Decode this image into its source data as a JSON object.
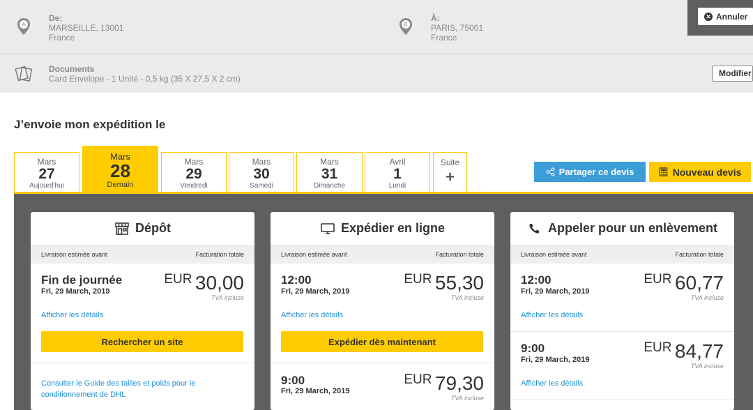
{
  "route": {
    "from": {
      "label": "De:",
      "city": "MARSEILLE, 13001",
      "country": "France",
      "marker": "A"
    },
    "to": {
      "label": "À:",
      "city": "PARIS, 75001",
      "country": "France",
      "marker": "B"
    },
    "cancel_label": "Annuler"
  },
  "package": {
    "type": "Documents",
    "description": "Card Envelope - 1 Unité - 0,5 kg (35 X 27,5 X 2 cm)",
    "modify_label": "Modifier"
  },
  "heading": "J’envoie mon expédition le",
  "tabs": [
    {
      "month": "Mars",
      "day": "27",
      "weekday": "Aujourd'hui"
    },
    {
      "month": "Mars",
      "day": "28",
      "weekday": "Demain"
    },
    {
      "month": "Mars",
      "day": "29",
      "weekday": "Vendredi"
    },
    {
      "month": "Mars",
      "day": "30",
      "weekday": "Samedi"
    },
    {
      "month": "Mars",
      "day": "31",
      "weekday": "Dimanche"
    },
    {
      "month": "Avril",
      "day": "1",
      "weekday": "Lundi"
    },
    {
      "month": "Suite",
      "day": "+",
      "weekday": ""
    }
  ],
  "actions": {
    "share_label": "Partager ce devis",
    "new_quote_label": "Nouveau devis"
  },
  "cards": [
    {
      "title": "Dépôt",
      "icon": "store-icon",
      "col_left": "Livraison estimée avant",
      "col_right": "Facturation totale",
      "options": [
        {
          "time": "Fin de journée",
          "date": "Fri, 29 March, 2019",
          "currency": "EUR",
          "amount": "30,00",
          "vat": "TVA incluse",
          "details": "Afficher les détails"
        }
      ],
      "button": "Rechercher un site",
      "guide": "Consulter le Guide des tailles et poids pour le conditionnement de DHL"
    },
    {
      "title": "Expédier en ligne",
      "icon": "monitor-icon",
      "col_left": "Livraison estimée avant",
      "col_right": "Facturation totale",
      "options": [
        {
          "time": "12:00",
          "date": "Fri, 29 March, 2019",
          "currency": "EUR",
          "amount": "55,30",
          "vat": "TVA incluse",
          "details": "Afficher les détails"
        },
        {
          "time": "9:00",
          "date": "Fri, 29 March, 2019",
          "currency": "EUR",
          "amount": "79,30",
          "vat": "TVA incluse"
        }
      ],
      "button": "Expédier dès maintenant"
    },
    {
      "title": "Appeler pour un enlèvement",
      "icon": "phone-icon",
      "col_left": "Livraison estimée avant",
      "col_right": "Facturation totale",
      "options": [
        {
          "time": "12:00",
          "date": "Fri, 29 March, 2019",
          "currency": "EUR",
          "amount": "60,77",
          "vat": "TVA incluse",
          "details": "Afficher les détails"
        },
        {
          "time": "9:00",
          "date": "Fri, 29 March, 2019",
          "currency": "EUR",
          "amount": "84,77",
          "vat": "TVA incluse",
          "details": "Afficher les détails"
        }
      ]
    }
  ],
  "colors": {
    "accent": "#fecc00",
    "link": "#1f8fd6",
    "share": "#3c9dd8",
    "panel": "#5f5f5f"
  }
}
